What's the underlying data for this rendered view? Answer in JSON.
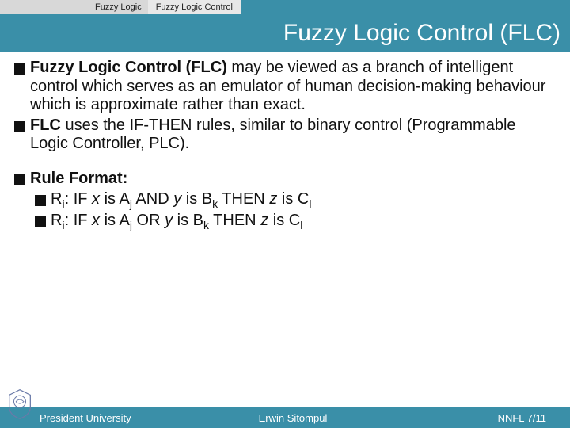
{
  "header": {
    "crumb1": "Fuzzy Logic",
    "crumb2": "Fuzzy Logic Control"
  },
  "title": "Fuzzy Logic Control (FLC)",
  "bullets": {
    "b1_bold": "Fuzzy Logic Control (FLC)",
    "b1_rest1": " may be viewed as a branch of ",
    "b1_intel": "intelligent",
    "b1_rest2": " control which serves as an emulator of human ",
    "b1_dec": "decision-making",
    "b1_rest3": " behaviour which is ",
    "b1_approx": "approximate",
    "b1_rest4": " rather than exact.",
    "b2_bold": "FLC",
    "b2_rest": " uses the IF-THEN rules, similar to binary control (Programmable Logic Controller, PLC).",
    "b3": "Rule Format:",
    "r1_pre": "R",
    "r1_sub": "i",
    "r1_a": ": IF ",
    "r1_x": "x",
    "r1_b": " is A",
    "r1_subj": "j",
    "r1_c": " AND ",
    "r1_y": "y",
    "r1_d": " is B",
    "r1_subk": "k",
    "r1_e": " THEN ",
    "r1_z": "z",
    "r1_f": " is C",
    "r1_subl": "l",
    "r2_pre": "R",
    "r2_sub": "i",
    "r2_a": ": IF ",
    "r2_x": "x",
    "r2_b": " is A",
    "r2_subj": "j",
    "r2_c": " OR ",
    "r2_y": "y",
    "r2_d": " is B",
    "r2_subk": "k",
    "r2_e": " THEN ",
    "r2_z": "z",
    "r2_f": " is C",
    "r2_subl": "l"
  },
  "footer": {
    "left": "President University",
    "center": "Erwin Sitompul",
    "right": "NNFL 7/11"
  }
}
